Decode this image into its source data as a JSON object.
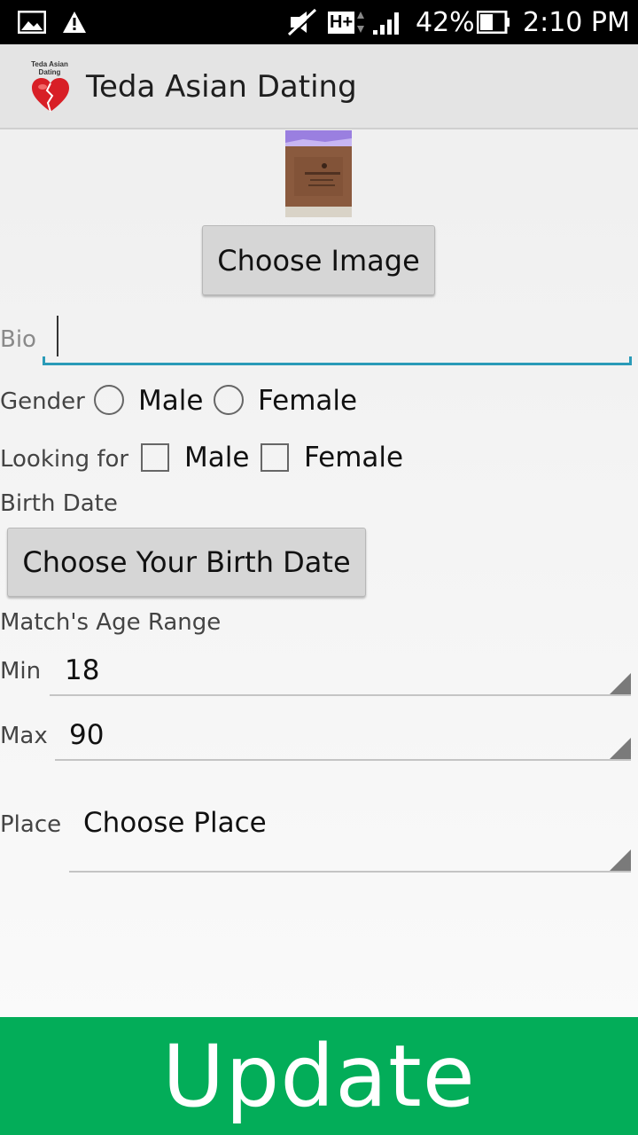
{
  "status_bar": {
    "battery": "42%",
    "time": "2:10 PM",
    "network": "H+",
    "icons": [
      "image-notification-icon",
      "warning-icon",
      "mute-icon",
      "network-type-icon",
      "signal-icon",
      "battery-icon"
    ]
  },
  "app_bar": {
    "logo_text": "Teda Asian Dating",
    "title": "Teda Asian Dating"
  },
  "profile": {
    "choose_image_label": "Choose Image",
    "bio_label": "Bio",
    "bio_value": ""
  },
  "gender": {
    "label": "Gender",
    "options": [
      "Male",
      "Female"
    ]
  },
  "looking_for": {
    "label": "Looking for",
    "options": [
      "Male",
      "Female"
    ]
  },
  "birth_date": {
    "label": "Birth Date",
    "button_label": "Choose Your Birth Date"
  },
  "age_range": {
    "label": "Match's Age Range",
    "min_label": "Min",
    "min_value": "18",
    "max_label": "Max",
    "max_value": "90"
  },
  "place": {
    "label": "Place",
    "value": "Choose Place"
  },
  "update_label": "Update",
  "colors": {
    "accent": "#2a9bb8",
    "update_button": "#03ad59",
    "status_bar": "#000000",
    "app_bar": "#e4e4e4"
  }
}
